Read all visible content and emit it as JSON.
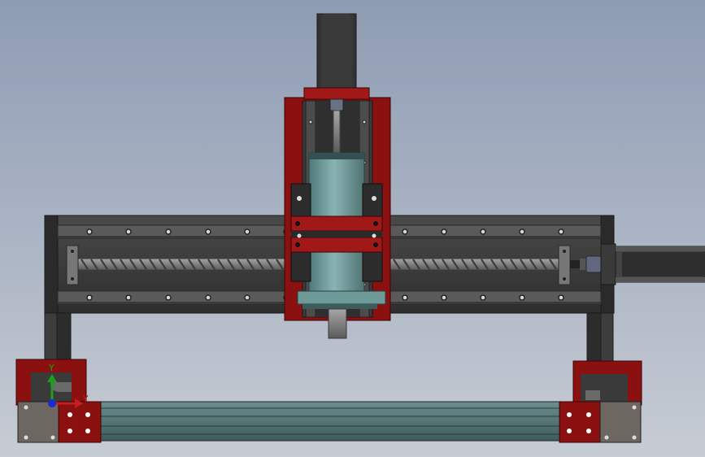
{
  "viewport": {
    "background_top": "#8e9cb3",
    "background_bottom": "#c7ccd4",
    "model_colors": {
      "frame_dark": "#3a3a3a",
      "frame_mid": "#555555",
      "plate_red": "#8b1010",
      "plate_red_light": "#b02020",
      "spindle_teal": "#6f9a9a",
      "rail_teal": "#5e7f7f",
      "metal_grey": "#7a7a7a"
    }
  },
  "triad": {
    "y_label": "Y",
    "x_label": "Y",
    "y_color": "#1aa01a",
    "x_color": "#c81e1e",
    "z_color": "#1a2bd0"
  }
}
